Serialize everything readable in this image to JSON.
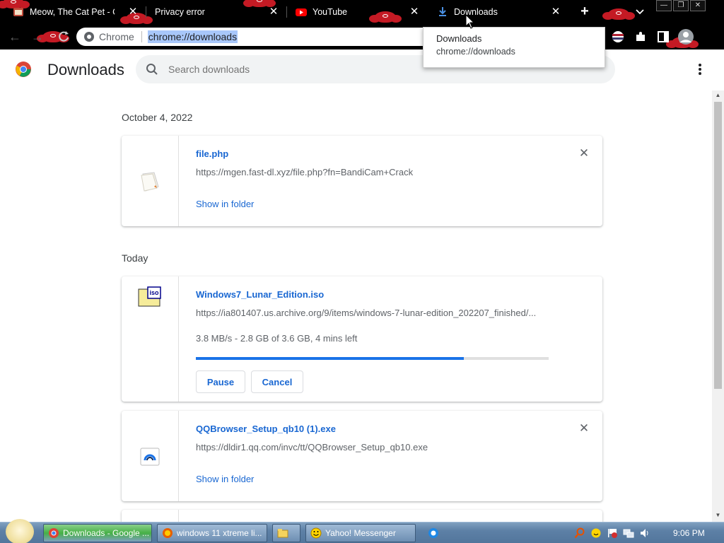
{
  "tabs": [
    {
      "title": "Meow, The Cat Pet - Chro",
      "favicon": "cat-favicon",
      "close": "✕"
    },
    {
      "title": "Privacy error",
      "favicon": "warning-favicon",
      "close": "✕"
    },
    {
      "title": "YouTube",
      "favicon": "youtube-icon",
      "close": "✕"
    },
    {
      "title": "Downloads",
      "favicon": "download-icon",
      "close": "✕"
    }
  ],
  "newtab_label": "+",
  "omnibox": {
    "site_label": "Chrome",
    "url": "chrome://downloads"
  },
  "tooltip": {
    "title": "Downloads",
    "url": "chrome://downloads"
  },
  "header": {
    "title": "Downloads",
    "search_placeholder": "Search downloads"
  },
  "groups": [
    {
      "date": "October 4, 2022",
      "items": [
        {
          "name": "file.php",
          "url": "https://mgen.fast-dl.xyz/file.php?fn=BandiCam+Crack",
          "action": "Show in folder"
        }
      ]
    },
    {
      "date": "Today",
      "items": [
        {
          "name": "Windows7_Lunar_Edition.iso",
          "url": "https://ia801407.us.archive.org/9/items/windows-7-lunar-edition_202207_finished/...",
          "status": "3.8 MB/s - 2.8 GB of 3.6 GB, 4 mins left",
          "progress_percent": 76,
          "pause_label": "Pause",
          "cancel_label": "Cancel"
        },
        {
          "name": "QQBrowser_Setup_qb10 (1).exe",
          "url": "https://dldir1.qq.com/invc/tt/QQBrowser_Setup_qb10.exe",
          "action": "Show in folder"
        }
      ]
    }
  ],
  "taskbar": {
    "items": [
      {
        "label": "Downloads - Google ..."
      },
      {
        "label": "windows 11 xtreme li..."
      },
      {
        "label": ""
      },
      {
        "label": "Yahoo! Messenger"
      }
    ],
    "clock": "9:06 PM"
  },
  "colors": {
    "accent": "#1a73e8",
    "link": "#1967d2",
    "tab_bg": "#000000",
    "akatsuki_red": "#c41a24"
  }
}
